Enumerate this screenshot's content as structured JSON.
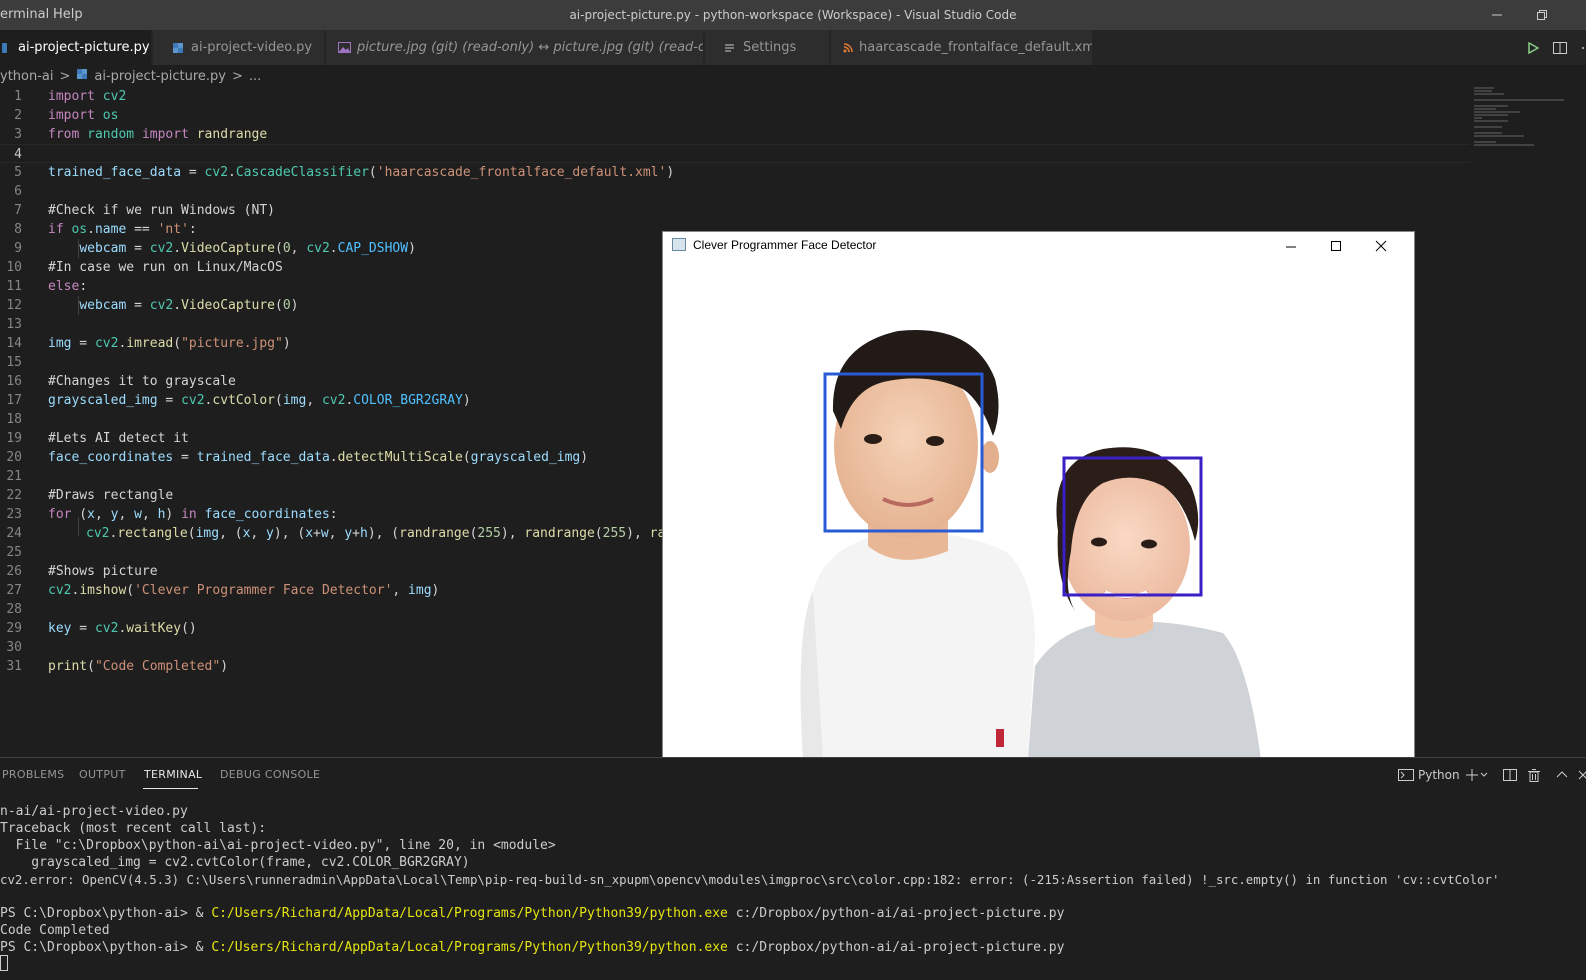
{
  "menu": {
    "terminal": "erminal",
    "help": "Help"
  },
  "window_title": "ai-project-picture.py - python-workspace (Workspace) - Visual Studio Code",
  "tabs": [
    {
      "label": "ai-project-picture.py",
      "active": true
    },
    {
      "label": "ai-project-video.py"
    },
    {
      "label": "picture.jpg (git) (read-only) ↔ picture.jpg (git) (read-only)"
    },
    {
      "label": "Settings"
    },
    {
      "label": "haarcascade_frontalface_default.xml"
    }
  ],
  "breadcrumb": {
    "folder": "ython-ai",
    "sep": ">",
    "file": "ai-project-picture.py",
    "sep2": ">",
    "more": "..."
  },
  "line_numbers": [
    "1",
    "2",
    "3",
    "4",
    "5",
    "6",
    "7",
    "8",
    "9",
    "10",
    "11",
    "12",
    "13",
    "14",
    "15",
    "16",
    "17",
    "18",
    "19",
    "20",
    "21",
    "22",
    "23",
    "24",
    "25",
    "26",
    "27",
    "28",
    "29",
    "30",
    "31"
  ],
  "code": {
    "l1": [
      "import",
      " cv2"
    ],
    "l2": [
      "import",
      " os"
    ],
    "l3": [
      "from",
      " random ",
      "import",
      " randrange"
    ],
    "l5": [
      "trained_face_data",
      " = ",
      "cv2",
      ".",
      "CascadeClassifier",
      "(",
      "'haarcascade_frontalface_default.xml'",
      ")"
    ],
    "l7": "#Check if we run Windows (NT)",
    "l8": [
      "if",
      " ",
      "os",
      ".",
      "name",
      " == ",
      "'nt'",
      ":"
    ],
    "l9": [
      "    ",
      "webcam",
      " = ",
      "cv2",
      ".",
      "VideoCapture",
      "(",
      "0",
      ", ",
      "cv2",
      ".",
      "CAP_DSHOW",
      ")"
    ],
    "l10": "#In case we run on Linux/MacOS",
    "l11": [
      "else",
      ":"
    ],
    "l12": [
      "    ",
      "webcam",
      " = ",
      "cv2",
      ".",
      "VideoCapture",
      "(",
      "0",
      ")"
    ],
    "l14": [
      "img",
      " = ",
      "cv2",
      ".",
      "imread",
      "(",
      "\"picture.jpg\"",
      ")"
    ],
    "l16": "#Changes it to grayscale",
    "l17": [
      "grayscaled_img",
      " = ",
      "cv2",
      ".",
      "cvtColor",
      "(",
      "img",
      ", ",
      "cv2",
      ".",
      "COLOR_BGR2GRAY",
      ")"
    ],
    "l19": "#Lets AI detect it",
    "l20": [
      "face_coordinates",
      " = ",
      "trained_face_data",
      ".",
      "detectMultiScale",
      "(",
      "grayscaled_img",
      ")"
    ],
    "l22": "#Draws rectangle",
    "l23": [
      "for",
      " (",
      "x",
      ", ",
      "y",
      ", ",
      "w",
      ", ",
      "h",
      ") ",
      "in",
      " ",
      "face_coordinates",
      ":"
    ],
    "l24": [
      "cv2",
      ".",
      "rectangle",
      "(",
      "img",
      ", (",
      "x",
      ", ",
      "y",
      "), (",
      "x",
      "+",
      "w",
      ", ",
      "y",
      "+",
      "h",
      "), (",
      "randrange",
      "(",
      "255",
      "), ",
      "randrange",
      "(",
      "255",
      "), ",
      "ran"
    ],
    "l26": "#Shows picture",
    "l27": [
      "cv2",
      ".",
      "imshow",
      "(",
      "'Clever Programmer Face Detector'",
      ", ",
      "img",
      ")"
    ],
    "l29": [
      "key",
      " = ",
      "cv2",
      ".",
      "waitKey",
      "()"
    ],
    "l31": [
      "print",
      "(",
      "\"Code Completed\"",
      ")"
    ]
  },
  "panel": {
    "tabs": [
      "PROBLEMS",
      "OUTPUT",
      "TERMINAL",
      "DEBUG CONSOLE"
    ],
    "active_tab": "TERMINAL",
    "shell": "Python",
    "terminal_lines": [
      "n-ai/ai-project-video.py",
      "Traceback (most recent call last):",
      "  File \"c:\\Dropbox\\python-ai\\ai-project-video.py\", line 20, in <module>",
      "    grayscaled_img = cv2.cvtColor(frame, cv2.COLOR_BGR2GRAY)",
      "cv2.error: OpenCV(4.5.3) C:\\Users\\runneradmin\\AppData\\Local\\Temp\\pip-req-build-sn_xpupm\\opencv\\modules\\imgproc\\src\\color.cpp:182: error: (-215:Assertion failed) !_src.empty() in function 'cv::cvtColor'",
      ""
    ],
    "prompt1": {
      "prompt": "PS C:\\Dropbox\\python-ai> & ",
      "exe": "C:/Users/Richard/AppData/Local/Programs/Python/Python39/python.exe",
      "arg": " c:/Dropbox/python-ai/ai-project-picture.py"
    },
    "output": "Code Completed",
    "prompt2": {
      "prompt": "PS C:\\Dropbox\\python-ai> & ",
      "exe": "C:/Users/Richard/AppData/Local/Programs/Python/Python39/python.exe",
      "arg": " c:/Dropbox/python-ai/ai-project-picture.py"
    }
  },
  "face_window": {
    "title": "Clever Programmer Face Detector",
    "box_colors": [
      "#2a5bd7",
      "#3a1fc4"
    ]
  },
  "colors": {
    "editor_bg": "#1e1e1e",
    "titlebar": "#3c3c3c",
    "tab_active": "#1e1e1e",
    "terminal_path": "#e5e510"
  }
}
